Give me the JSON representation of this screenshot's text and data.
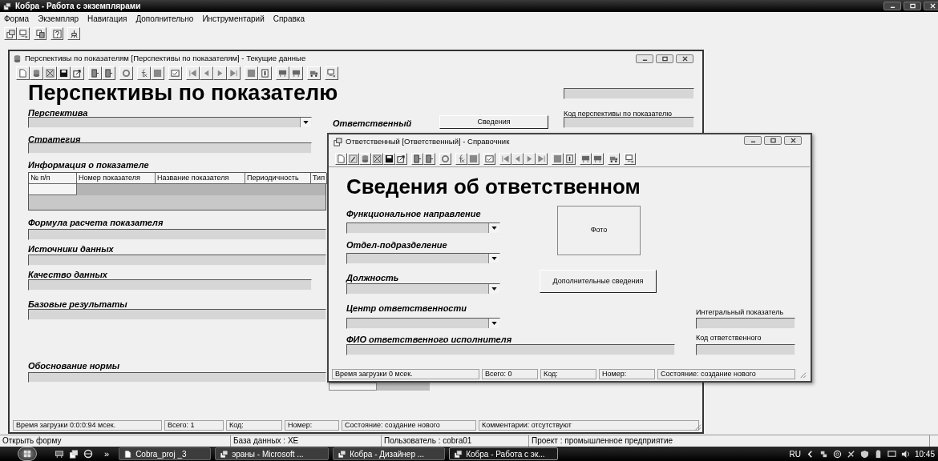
{
  "app": {
    "title": "Кобра - Работа с экземплярами",
    "menu": [
      "Форма",
      "Экземпляр",
      "Навигация",
      "Дополнительно",
      "Инструментарий",
      "Справка"
    ],
    "status_bar": [
      "Открыть форму",
      "База данных : XE",
      "Пользователь : cobra01",
      "Проект : промышленное предприятие"
    ]
  },
  "window_1": {
    "title": "Перспективы по показателям [Перспективы по показателям] - Текущие данные",
    "heading": "Перспективы по показателю",
    "labels": [
      "Перспектива",
      "Стратегия",
      "Информация о показателе",
      "Формула расчета показателя",
      "Источники данных",
      "Качество данных",
      "Базовые результаты",
      "Обоснование нормы"
    ],
    "responsible_label": "Ответственный",
    "details_button": "Сведения",
    "code_label": "Код перспективы по показателю",
    "table": {
      "columns": [
        "№ п/п",
        "Номер показателя",
        "Название показателя",
        "Периодичность",
        "Тип"
      ]
    },
    "status_bar": [
      "Время загрузки 0:0:0:94 мсек.",
      "Всего: 1",
      "Код:",
      "Номер:",
      "Состояние: создание нового",
      "Комментарии: отсутствуют"
    ]
  },
  "window_2": {
    "title": "Ответственный [Ответственный] - Справочник",
    "heading": "Сведения об ответственном",
    "labels": [
      "Функциональное направление",
      "Отдел-подразделение",
      "Должность",
      "Центр ответственности",
      "ФИО ответственного исполнителя"
    ],
    "photo": "Фото",
    "more_button": "Дополнительные сведения",
    "integral_label": "Интегральный показатель",
    "code_label": "Код ответственного",
    "status_bar": [
      "Время загрузки 0 мсек.",
      "Всего: 0",
      "Код:",
      "Номер:",
      "Состояние: создание нового"
    ]
  },
  "taskbar": {
    "overflow": "»",
    "buttons": [
      {
        "label": "Cobra_proj _3",
        "selected": false
      },
      {
        "label": "эраны - Microsoft ...",
        "selected": false
      },
      {
        "label": "Кобра - Дизайнер ...",
        "selected": false
      },
      {
        "label": "Кобра - Работа с эк...",
        "selected": true
      }
    ],
    "language": "RU",
    "clock": "10:45"
  }
}
